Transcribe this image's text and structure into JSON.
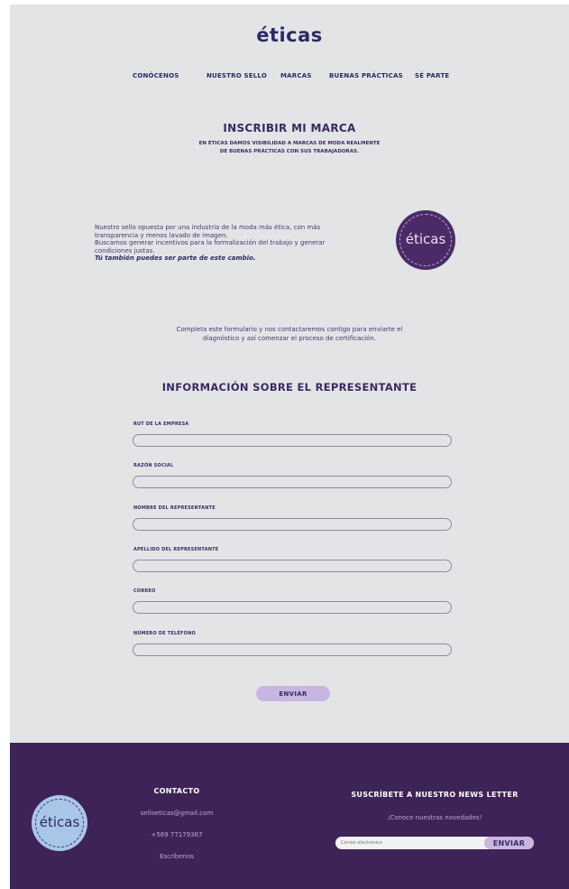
{
  "brand": {
    "logo": "éticas"
  },
  "nav": {
    "items": [
      "CONÓCENOS",
      "NUESTRO SELLO",
      "MARCAS",
      "BUENAS PRÁCTICAS",
      "SÉ PARTE"
    ]
  },
  "hero": {
    "title": "INSCRIBIR MI MARCA",
    "subtitle_line1": "EN ÉTICAS DAMOS VISIBILIDAD A MARCAS DE MODA REALMENTE",
    "subtitle_line2": "DE BUENAS PRÁCTICAS CON SUS TRABAJADORAS."
  },
  "about": {
    "line1": "Nuestro sello opuesta por una industria de la moda más ética, con más",
    "line2": "transparencia y menos lavado de imagen.",
    "line3": "Buscamos generar incentivos para la formalización del trabajo y generar",
    "line4": "condiciones justas.",
    "emphasis": "Tú también puedes ser parte de este cambio.",
    "badge_text": "éticas"
  },
  "intro": {
    "line1": "Completa este formulario y nos contactaremos contigo para enviarte el",
    "line2": "diagnóstico y así comenzar el proceso de certificación."
  },
  "form": {
    "title": "INFORMACIÓN SOBRE EL REPRESENTANTE",
    "fields": [
      {
        "label": "RUT DE LA EMPRESA",
        "value": ""
      },
      {
        "label": "RAZÓN SOCIAL",
        "value": ""
      },
      {
        "label": "NOMBRE DEL REPRESENTANTE",
        "value": ""
      },
      {
        "label": "APELLIDO DEL REPRESENTANTE",
        "value": ""
      },
      {
        "label": "CORREO",
        "value": ""
      },
      {
        "label": "NÚMERO DE TELÉFONO",
        "value": ""
      }
    ],
    "submit_label": "ENVIAR"
  },
  "footer": {
    "badge_text": "éticas",
    "contact": {
      "title": "CONTACTO",
      "email": "selloeticas@gmail.com",
      "phone": "+569 77179367",
      "write": "Escríbenos"
    },
    "newsletter": {
      "title": "SUSCRÍBETE A NUESTRO NEWS LETTER",
      "subtitle": "¡Conoce nuestras novedades!",
      "placeholder": "Correo electrónico",
      "button_label": "ENVIAR"
    }
  },
  "colors": {
    "background": "#e3e4e6",
    "primary_text": "#3b2a62",
    "footer": "#3e2358",
    "accent": "#c9b6e0"
  }
}
